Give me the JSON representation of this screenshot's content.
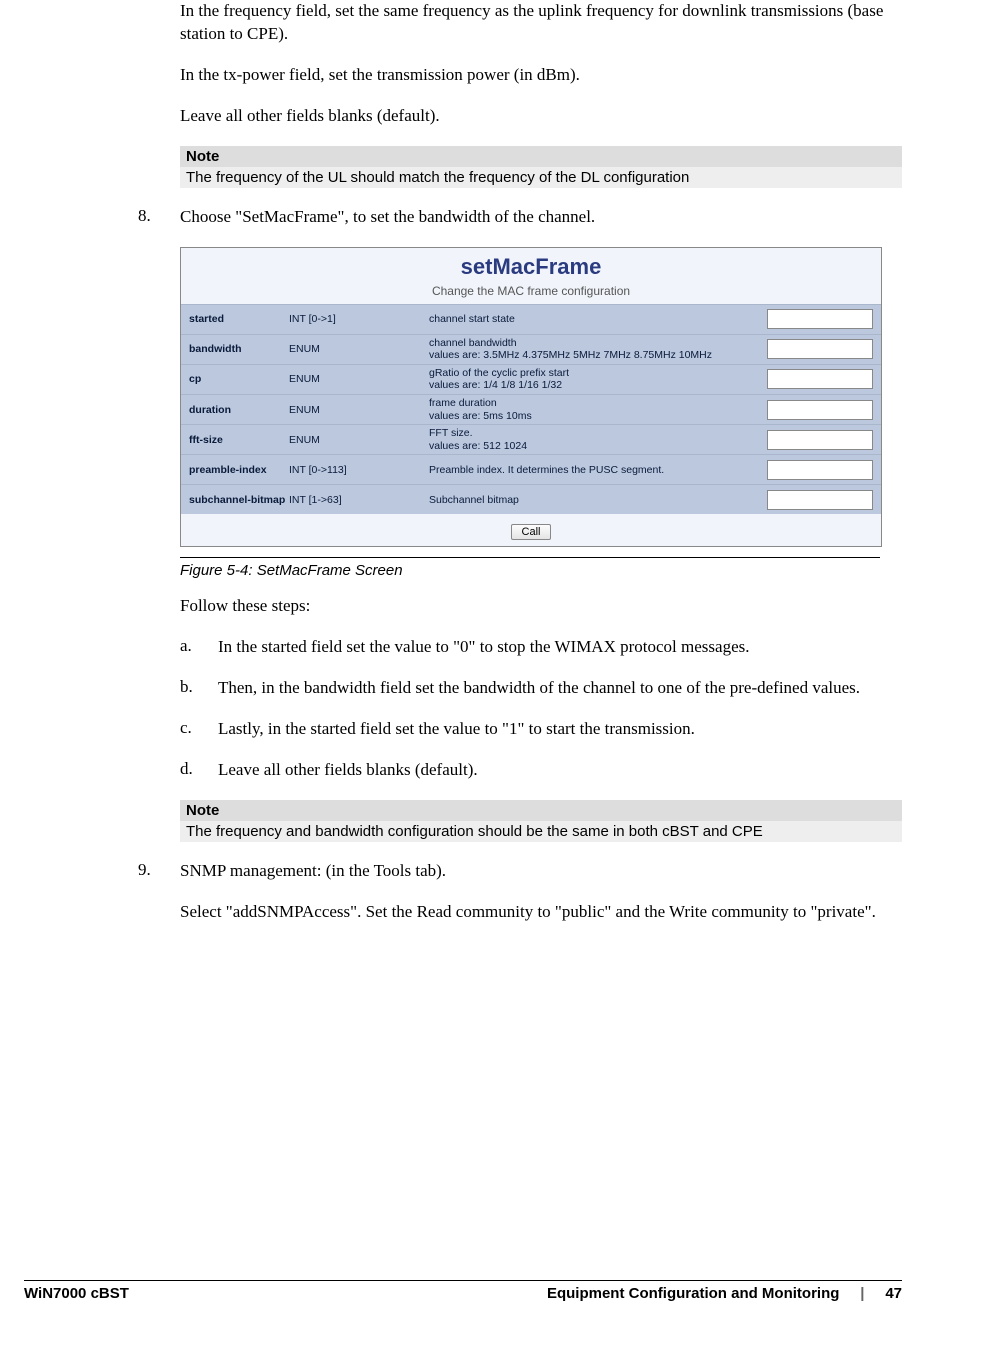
{
  "para1": "In the frequency field, set the same frequency as the uplink frequency for downlink transmissions (base station to CPE).",
  "para2": "In the tx-power field, set the transmission power (in dBm).",
  "para3": "Leave all other fields blanks (default).",
  "note1": {
    "header": "Note",
    "body": "The frequency of the UL should match the frequency of the DL configuration"
  },
  "step8": {
    "num": "8.",
    "text": "Choose \"SetMacFrame\", to set the bandwidth of the channel."
  },
  "screen": {
    "title": "setMacFrame",
    "subtitle": "Change the MAC frame configuration",
    "fields": [
      {
        "name": "started",
        "type": "INT [0->1]",
        "desc": "channel start state"
      },
      {
        "name": "bandwidth",
        "type": "ENUM",
        "desc": "channel bandwidth\nvalues are: 3.5MHz 4.375MHz 5MHz 7MHz 8.75MHz 10MHz"
      },
      {
        "name": "cp",
        "type": "ENUM",
        "desc": "gRatio of the cyclic prefix start\nvalues are: 1/4 1/8 1/16 1/32"
      },
      {
        "name": "duration",
        "type": "ENUM",
        "desc": "frame duration\nvalues are: 5ms 10ms"
      },
      {
        "name": "fft-size",
        "type": "ENUM",
        "desc": "FFT size.\nvalues are: 512 1024"
      },
      {
        "name": "preamble-index",
        "type": "INT [0->113]",
        "desc": "Preamble index. It determines the PUSC segment."
      },
      {
        "name": "subchannel-bitmap",
        "type": "INT [1->63]",
        "desc": "Subchannel bitmap"
      }
    ],
    "call": "Call"
  },
  "figcap": "Figure 5-4: SetMacFrame Screen",
  "follow": "Follow these steps:",
  "sub": {
    "a": {
      "l": "a.",
      "t": "In the started field set the value to \"0\" to stop the WIMAX protocol messages."
    },
    "b": {
      "l": "b.",
      "t": "Then, in the bandwidth field set the bandwidth of the channel to one of the pre-defined values."
    },
    "c": {
      "l": "c.",
      "t": "Lastly, in the started field set the value to \"1\" to start the transmission."
    },
    "d": {
      "l": "d.",
      "t": "Leave all other fields blanks (default)."
    }
  },
  "note2": {
    "header": "Note",
    "body": "The frequency and bandwidth configuration should be the same in both cBST and CPE"
  },
  "step9": {
    "num": "9.",
    "text": "SNMP management: (in the Tools tab)."
  },
  "step9b": "Select \"addSNMPAccess\". Set the Read community to \"public\" and the Write community to \"private\".",
  "footer": {
    "left": "WiN7000 cBST",
    "mid": "Equipment Configuration and Monitoring",
    "sep": "|",
    "page": "47"
  }
}
